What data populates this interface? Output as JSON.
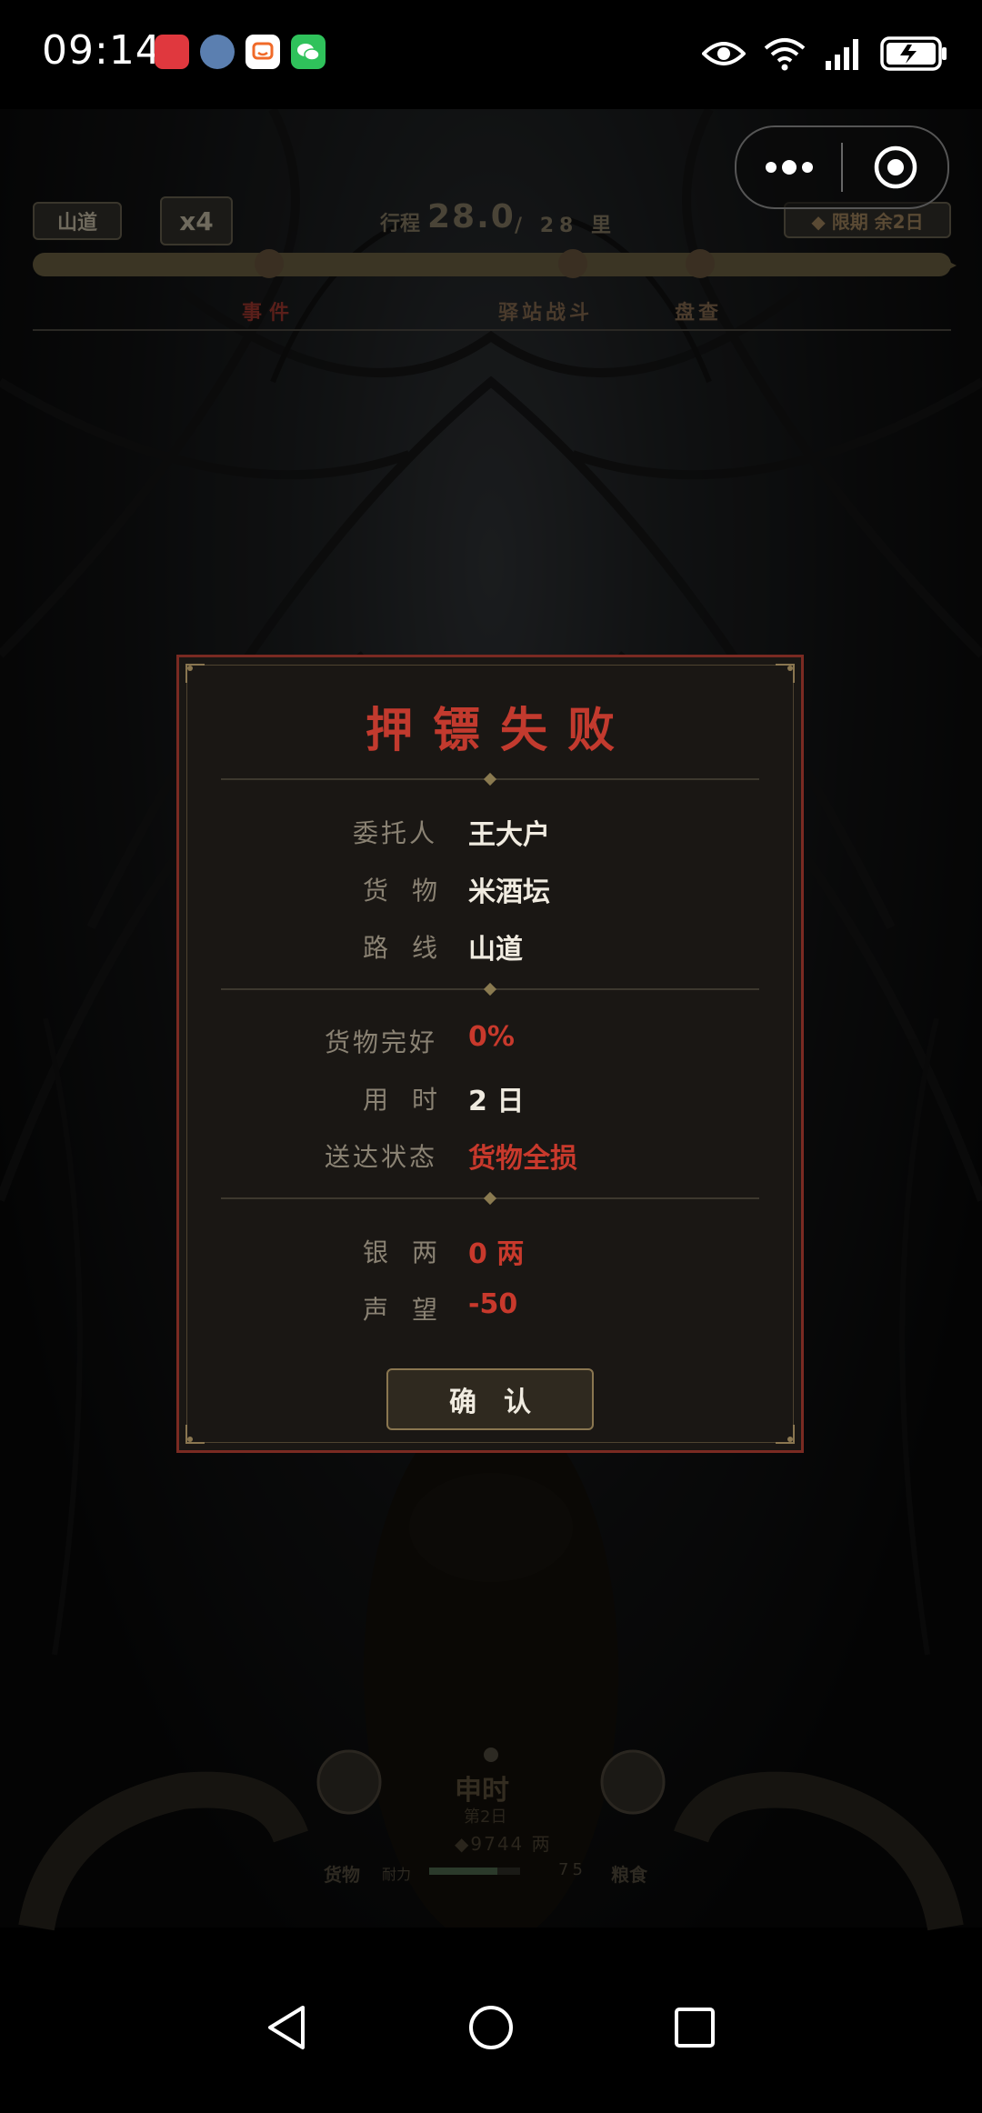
{
  "status_bar": {
    "time": "09:14",
    "battery_icon": "battery-charging-icon",
    "icons": [
      "huawei-appgallery-icon",
      "avatar-app-icon",
      "douyu-icon",
      "wechat-icon",
      "eye-comfort-icon",
      "wifi-6-icon",
      "signal-icon",
      "battery-charging-icon"
    ]
  },
  "mini_program_capsule": {
    "more_icon": "more-dots-icon",
    "close_icon": "target-circle-icon"
  },
  "game_hud": {
    "location": "山道",
    "speed": "x4",
    "distance_label": "行程",
    "distance_value": "28.0",
    "distance_total": "/ 28 里",
    "deadline": "◆ 限期 余2日",
    "markers": [
      "事件",
      "驿站战斗",
      "盘查"
    ]
  },
  "bottom_hud": {
    "time_of_day": "申时",
    "day": "第2日",
    "silver": "◆9744 两",
    "cargo_label": "货物",
    "durability_label": "耐力",
    "durability_value": "75",
    "durability_fraction": 0.75,
    "food_label": "粮食"
  },
  "dialog": {
    "title": "押镖失败",
    "client_label": "委托人",
    "client_value": "王大户",
    "cargo_label": "货物",
    "cargo_value": "米酒坛",
    "route_label": "路线",
    "route_value": "山道",
    "integrity_label": "货物完好",
    "integrity_value": "0%",
    "time_label": "用时",
    "time_value": "2 日",
    "status_label": "送达状态",
    "status_value": "货物全损",
    "silver_label": "银两",
    "silver_value": "0 两",
    "reputation_label": "声望",
    "reputation_value": "-50",
    "confirm_label": "确认"
  },
  "colors": {
    "accent_red": "#c8392c",
    "gold": "#8a7650",
    "panel_bg": "#1a1714"
  }
}
